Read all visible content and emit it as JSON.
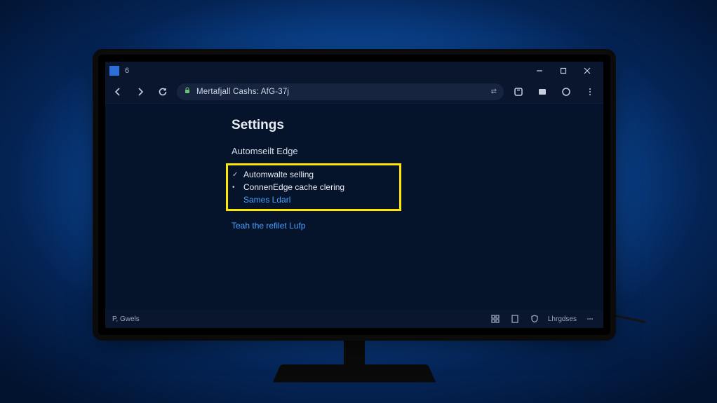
{
  "window": {
    "tab_title": "6",
    "address": "Mertafjall Cashs: AfG-37j"
  },
  "page": {
    "heading": "Settings",
    "section": "Automseilt Edge",
    "options": [
      {
        "mark": "✓",
        "label": "Automwalte selling"
      },
      {
        "mark": "•",
        "label": "ConnenEdge cache clering"
      },
      {
        "mark": "",
        "label": "Sames Ldarl"
      }
    ],
    "link": "Teah the refilet Lufp"
  },
  "statusbar": {
    "left": "P, Gwels",
    "right_label": "Lhrgdses"
  }
}
